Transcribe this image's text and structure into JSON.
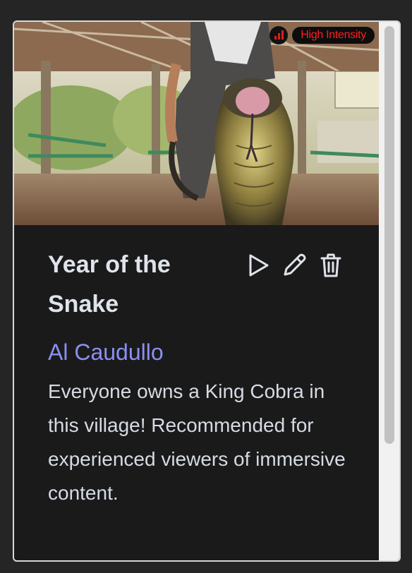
{
  "video": {
    "intensity_label": "High Intensity",
    "title": "Year of the Snake",
    "author": "Al Caudullo",
    "description": "Everyone owns a King Cobra in this village! Recommended for experienced viewers of immersive content."
  },
  "colors": {
    "accent_author": "#8c8ff2",
    "intensity_red": "#ff1e1e",
    "card_bg": "#1a1a1b"
  },
  "icons": [
    "signal-bars-icon",
    "play-icon",
    "pencil-icon",
    "trash-icon"
  ]
}
